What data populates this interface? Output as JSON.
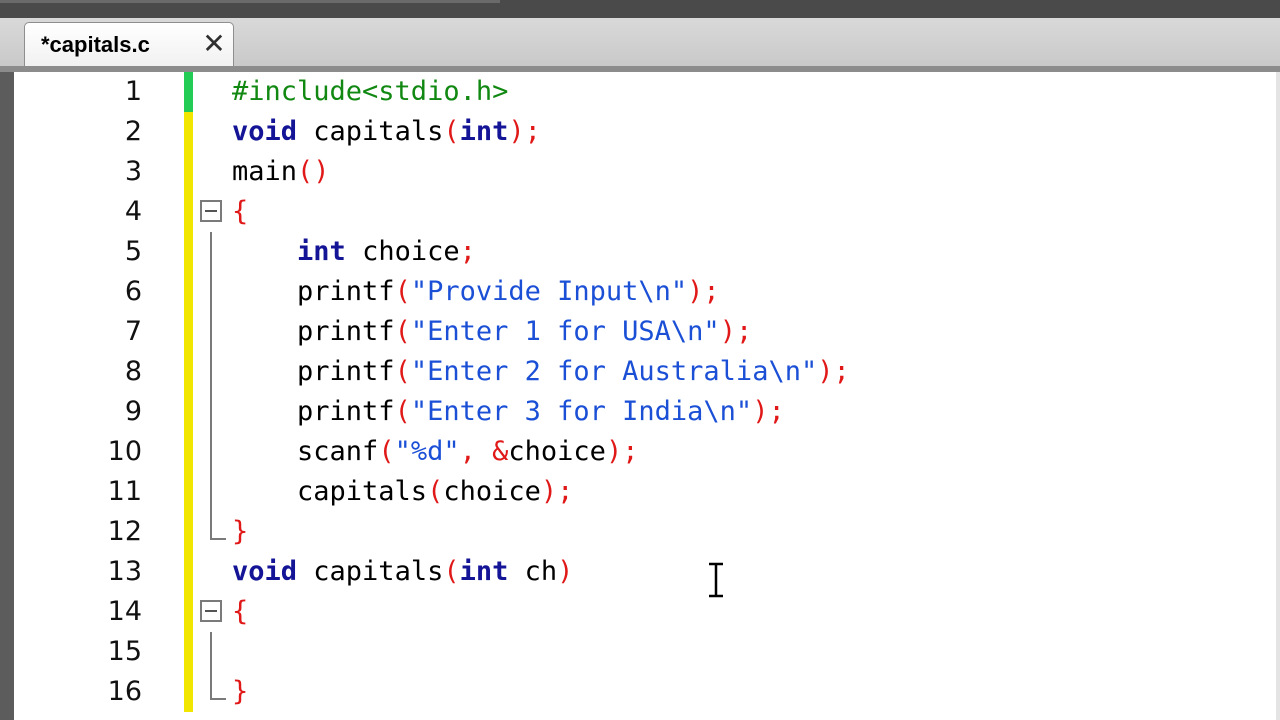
{
  "tabs": [
    {
      "label": "*capitals.c",
      "close_glyph": "✕",
      "close_icon": "close-icon"
    }
  ],
  "colors": {
    "keyword": "#141496",
    "preprocessor": "#118811",
    "operator": "#e01818",
    "string": "#1a4fd6",
    "modified_marker": "#f0e600",
    "saved_marker": "#22cc55"
  },
  "editor": {
    "lines": [
      {
        "number": "1",
        "tokens": [
          {
            "t": "#include<stdio.h>",
            "c": "pp"
          }
        ]
      },
      {
        "number": "2",
        "tokens": [
          {
            "t": "void",
            "c": "kw"
          },
          {
            "t": " capitals",
            "c": ""
          },
          {
            "t": "(",
            "c": "op"
          },
          {
            "t": "int",
            "c": "kw"
          },
          {
            "t": ");",
            "c": "op"
          }
        ]
      },
      {
        "number": "3",
        "tokens": [
          {
            "t": "main",
            "c": ""
          },
          {
            "t": "()",
            "c": "op"
          }
        ]
      },
      {
        "number": "4",
        "tokens": [
          {
            "t": "{",
            "c": "op"
          }
        ]
      },
      {
        "number": "5",
        "tokens": [
          {
            "t": "    ",
            "c": ""
          },
          {
            "t": "int",
            "c": "kw"
          },
          {
            "t": " choice",
            "c": ""
          },
          {
            "t": ";",
            "c": "op"
          }
        ]
      },
      {
        "number": "6",
        "tokens": [
          {
            "t": "    printf",
            "c": ""
          },
          {
            "t": "(",
            "c": "op"
          },
          {
            "t": "\"Provide Input\\n\"",
            "c": "st"
          },
          {
            "t": ");",
            "c": "op"
          }
        ]
      },
      {
        "number": "7",
        "tokens": [
          {
            "t": "    printf",
            "c": ""
          },
          {
            "t": "(",
            "c": "op"
          },
          {
            "t": "\"Enter 1 for USA\\n\"",
            "c": "st"
          },
          {
            "t": ");",
            "c": "op"
          }
        ]
      },
      {
        "number": "8",
        "tokens": [
          {
            "t": "    printf",
            "c": ""
          },
          {
            "t": "(",
            "c": "op"
          },
          {
            "t": "\"Enter 2 for Australia\\n\"",
            "c": "st"
          },
          {
            "t": ");",
            "c": "op"
          }
        ]
      },
      {
        "number": "9",
        "tokens": [
          {
            "t": "    printf",
            "c": ""
          },
          {
            "t": "(",
            "c": "op"
          },
          {
            "t": "\"Enter 3 for India\\n\"",
            "c": "st"
          },
          {
            "t": ");",
            "c": "op"
          }
        ]
      },
      {
        "number": "10",
        "tokens": [
          {
            "t": "    scanf",
            "c": ""
          },
          {
            "t": "(",
            "c": "op"
          },
          {
            "t": "\"%d\"",
            "c": "st"
          },
          {
            "t": ", &",
            "c": "op"
          },
          {
            "t": "choice",
            "c": ""
          },
          {
            "t": ");",
            "c": "op"
          }
        ]
      },
      {
        "number": "11",
        "tokens": [
          {
            "t": "    capitals",
            "c": ""
          },
          {
            "t": "(",
            "c": "op"
          },
          {
            "t": "choice",
            "c": ""
          },
          {
            "t": ");",
            "c": "op"
          }
        ]
      },
      {
        "number": "12",
        "tokens": [
          {
            "t": "}",
            "c": "op"
          }
        ]
      },
      {
        "number": "13",
        "tokens": [
          {
            "t": "void",
            "c": "kw"
          },
          {
            "t": " capitals",
            "c": ""
          },
          {
            "t": "(",
            "c": "op"
          },
          {
            "t": "int",
            "c": "kw"
          },
          {
            "t": " ch",
            "c": ""
          },
          {
            "t": ")",
            "c": "op"
          }
        ]
      },
      {
        "number": "14",
        "tokens": [
          {
            "t": "{",
            "c": "op"
          }
        ]
      },
      {
        "number": "15",
        "tokens": []
      },
      {
        "number": "16",
        "tokens": [
          {
            "t": "}",
            "c": "op"
          }
        ]
      }
    ],
    "line_markers": [
      "saved",
      "modified",
      "modified",
      "modified",
      "modified",
      "modified",
      "modified",
      "modified",
      "modified",
      "modified",
      "modified",
      "modified",
      "modified",
      "modified",
      "modified",
      "modified"
    ],
    "folds": [
      "",
      "",
      "",
      "start",
      "mid",
      "mid",
      "mid",
      "mid",
      "mid",
      "mid",
      "mid",
      "end",
      "",
      "start",
      "mid",
      "end"
    ],
    "cursor_icon": "text-cursor-icon"
  }
}
